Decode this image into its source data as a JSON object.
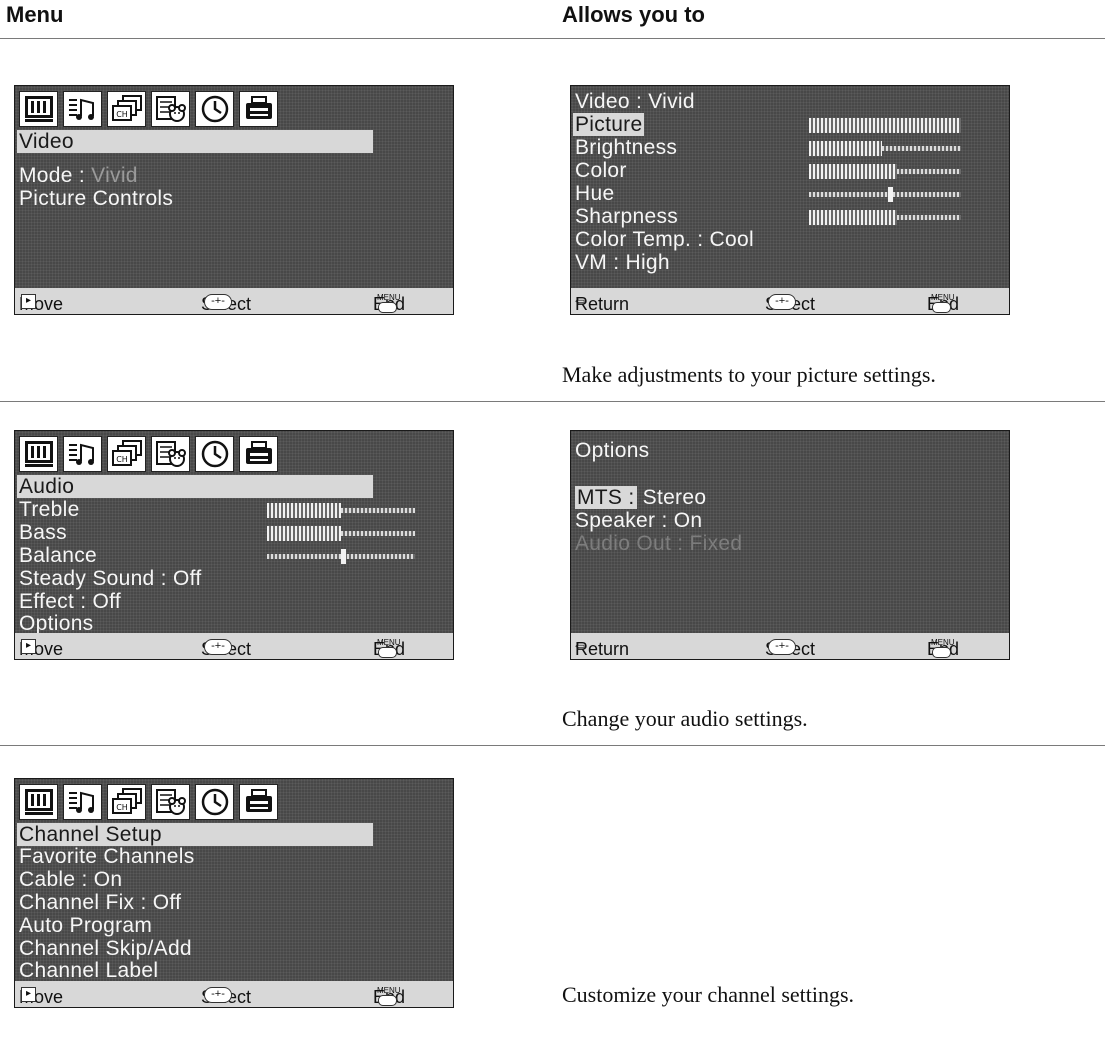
{
  "headers": {
    "menu": "Menu",
    "allows": "Allows you to"
  },
  "descriptions": [
    "Make adjustments to your picture settings.",
    "Change your audio settings.",
    "Customize your channel settings."
  ],
  "footer": {
    "move": "Move",
    "select": "Select",
    "end": "End",
    "return": "Return",
    "menu_key": "MENU",
    "ch_key": "CH"
  },
  "icons": [
    "tv-icon",
    "music-notes-icon",
    "channel-icon",
    "kids-icon",
    "clock-icon",
    "setup-icon"
  ],
  "video_menu": {
    "title": "Video",
    "mode_label": "Mode :",
    "mode_value": "Vivid",
    "picture_controls": "Picture Controls"
  },
  "picture_menu": {
    "title": "Video : Vivid",
    "items": [
      {
        "label": "Picture",
        "level": 1.0,
        "type": "level"
      },
      {
        "label": "Brightness",
        "level": 0.48,
        "type": "level"
      },
      {
        "label": "Color",
        "level": 0.58,
        "type": "level"
      },
      {
        "label": "Hue",
        "level": 0.52,
        "type": "center"
      },
      {
        "label": "Sharpness",
        "level": 0.58,
        "type": "level"
      }
    ],
    "color_temp": "Color Temp. : Cool",
    "vm": "VM : High"
  },
  "audio_menu": {
    "title": "Audio",
    "items": [
      {
        "label": "Treble",
        "level": 0.5,
        "type": "level"
      },
      {
        "label": "Bass",
        "level": 0.5,
        "type": "level"
      },
      {
        "label": "Balance",
        "level": 0.5,
        "type": "center"
      }
    ],
    "steady_sound": "Steady Sound : Off",
    "effect": "Effect : Off",
    "options": "Options"
  },
  "options_menu": {
    "title": "Options",
    "mts_label": "MTS :",
    "mts_value": "Stereo",
    "speaker": "Speaker : On",
    "audio_out": "Audio Out : Fixed"
  },
  "channel_menu": {
    "items": [
      "Channel Setup",
      "Favorite Channels",
      "Cable : On",
      "Channel Fix : Off",
      "Auto Program",
      "Channel Skip/Add",
      "Channel Label"
    ]
  }
}
